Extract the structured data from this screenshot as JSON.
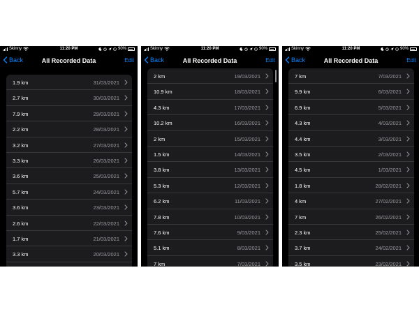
{
  "colors": {
    "accent": "#0a84ff",
    "background": "#000000",
    "cell": "#1c1c1e",
    "secondary_text": "#9c9ca1"
  },
  "icons": [
    "signal-icon",
    "wifi-icon",
    "moon-icon",
    "location-icon",
    "alarm-icon",
    "battery-icon",
    "back-chevron-icon",
    "chevron-right-icon"
  ],
  "panels": [
    {
      "status": {
        "carrier": "Skinny",
        "time": "11:20 PM",
        "battery": "90%",
        "battery_level": 0.9
      },
      "nav": {
        "back": "Back",
        "title": "All Recorded Data",
        "edit": "Edit"
      },
      "rows": [
        {
          "distance": "1.9 km",
          "date": "31/03/2021"
        },
        {
          "distance": "2.7 km",
          "date": "30/03/2021"
        },
        {
          "distance": "7.9 km",
          "date": "29/03/2021"
        },
        {
          "distance": "2.2 km",
          "date": "28/03/2021"
        },
        {
          "distance": "3.2 km",
          "date": "27/03/2021"
        },
        {
          "distance": "3.3 km",
          "date": "26/03/2021"
        },
        {
          "distance": "3.6 km",
          "date": "25/03/2021"
        },
        {
          "distance": "5.7 km",
          "date": "24/03/2021"
        },
        {
          "distance": "3.6 km",
          "date": "23/03/2021"
        },
        {
          "distance": "2.6 km",
          "date": "22/03/2021"
        },
        {
          "distance": "1.7 km",
          "date": "21/03/2021"
        },
        {
          "distance": "3.3 km",
          "date": "20/03/2021"
        },
        {
          "distance": "",
          "date": ""
        }
      ]
    },
    {
      "status": {
        "carrier": "Skinny",
        "time": "11:20 PM",
        "battery": "90%",
        "battery_level": 0.9
      },
      "nav": {
        "back": "Back",
        "title": "All Recorded Data",
        "edit": "Edit"
      },
      "rows": [
        {
          "distance": "2 km",
          "date": "19/03/2021"
        },
        {
          "distance": "10.9 km",
          "date": "18/03/2021"
        },
        {
          "distance": "4.3 km",
          "date": "17/03/2021"
        },
        {
          "distance": "10.2 km",
          "date": "16/03/2021"
        },
        {
          "distance": "2 km",
          "date": "15/03/2021"
        },
        {
          "distance": "1.5 km",
          "date": "14/03/2021"
        },
        {
          "distance": "3.8 km",
          "date": "13/03/2021"
        },
        {
          "distance": "5.3 km",
          "date": "12/03/2021"
        },
        {
          "distance": "6.2 km",
          "date": "11/03/2021"
        },
        {
          "distance": "7.8 km",
          "date": "10/03/2021"
        },
        {
          "distance": "7.6 km",
          "date": "9/03/2021"
        },
        {
          "distance": "5.1 km",
          "date": "8/03/2021"
        },
        {
          "distance": "7 km",
          "date": "7/03/2021"
        },
        {
          "distance": "",
          "date": ""
        }
      ]
    },
    {
      "status": {
        "carrier": "Skinny",
        "time": "11:20 PM",
        "battery": "90%",
        "battery_level": 0.9
      },
      "nav": {
        "back": "Back",
        "title": "All Recorded Data",
        "edit": "Edit"
      },
      "rows": [
        {
          "distance": "7 km",
          "date": "7/03/2021"
        },
        {
          "distance": "9.9 km",
          "date": "6/03/2021"
        },
        {
          "distance": "6.9 km",
          "date": "5/03/2021"
        },
        {
          "distance": "4.3 km",
          "date": "4/03/2021"
        },
        {
          "distance": "4.4 km",
          "date": "3/03/2021"
        },
        {
          "distance": "3.5 km",
          "date": "2/03/2021"
        },
        {
          "distance": "4.5 km",
          "date": "1/03/2021"
        },
        {
          "distance": "1.8 km",
          "date": "28/02/2021"
        },
        {
          "distance": "4 km",
          "date": "27/02/2021"
        },
        {
          "distance": "7 km",
          "date": "26/02/2021"
        },
        {
          "distance": "2.3 km",
          "date": "25/02/2021"
        },
        {
          "distance": "3.7 km",
          "date": "24/02/2021"
        },
        {
          "distance": "3.5 km",
          "date": "23/02/2021"
        },
        {
          "distance": "",
          "date": ""
        }
      ]
    }
  ]
}
